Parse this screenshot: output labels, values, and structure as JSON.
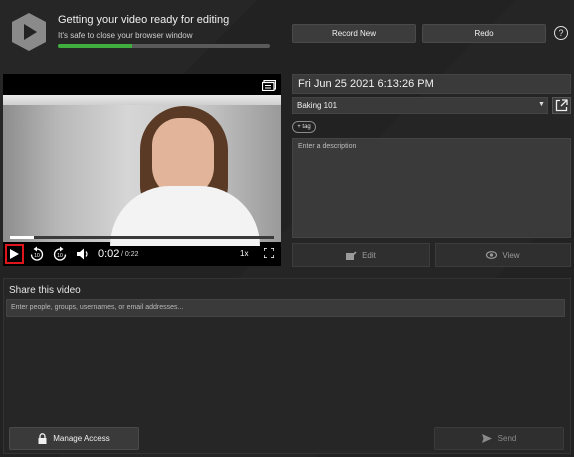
{
  "header": {
    "status_title": "Getting your video ready for editing",
    "status_subtitle": "It's safe to close your browser window",
    "progress_fraction": 0.35,
    "record_new_label": "Record New",
    "redo_label": "Redo",
    "help_label": "?"
  },
  "player": {
    "current_time": "0:02",
    "total_time": "/ 0:22",
    "speed": "1x",
    "seek_fraction": 0.09,
    "icons": [
      "captions-icon",
      "play-icon",
      "rewind-10-icon",
      "forward-10-icon",
      "volume-icon",
      "fullscreen-icon"
    ]
  },
  "details": {
    "date_value": "Fri Jun 25 2021 6:13:26 PM",
    "folder_value": "Baking 101",
    "tag_label": "+ tag",
    "description_placeholder": "Enter a description",
    "edit_label": "Edit",
    "view_label": "View"
  },
  "share": {
    "title": "Share this video",
    "input_placeholder": "Enter people, groups, usernames, or email addresses...",
    "manage_access_label": "Manage Access",
    "send_label": "Send"
  },
  "colors": {
    "accent_progress": "#3fae3f",
    "play_highlight": "#e0151b",
    "background": "#222222"
  }
}
